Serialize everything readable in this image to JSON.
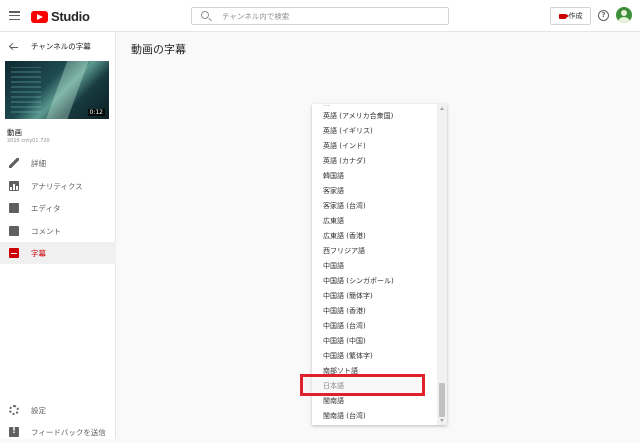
{
  "header": {
    "logo_text": "Studio",
    "search_placeholder": "チャンネル内で検索",
    "create_label": "作成",
    "help_symbol": "?"
  },
  "sidebar": {
    "back_label": "チャンネルの字幕",
    "video_duration": "0:12",
    "video_title": "動画",
    "video_subtitle": "2015 cnty01 720",
    "nav": [
      {
        "label": "詳細",
        "icon": "pencil-icon"
      },
      {
        "label": "アナリティクス",
        "icon": "analytics-icon"
      },
      {
        "label": "エディタ",
        "icon": "editor-icon"
      },
      {
        "label": "コメント",
        "icon": "comment-icon"
      },
      {
        "label": "字幕",
        "icon": "subtitles-icon",
        "active": true
      }
    ],
    "footer": [
      {
        "label": "設定",
        "icon": "gear-icon"
      },
      {
        "label": "フィードバックを送信",
        "icon": "feedback-icon"
      }
    ]
  },
  "main": {
    "title": "動画の字幕"
  },
  "language_dropdown": {
    "items": [
      "英語 (アメリカ合衆国)",
      "英語 (イギリス)",
      "英語 (インド)",
      "英語 (カナダ)",
      "韓国語",
      "客家語",
      "客家語 (台湾)",
      "広東語",
      "広東語 (香港)",
      "西フリジア語",
      "中国語",
      "中国語 (シンガポール)",
      "中国語 (簡体字)",
      "中国語 (香港)",
      "中国語 (台湾)",
      "中国語 (中国)",
      "中国語 (繁体字)",
      "南部ソト語",
      "日本語",
      "閩南語",
      "閩南語 (台湾)"
    ],
    "highlighted": "日本語"
  },
  "colors": {
    "accent_red": "#cc0000",
    "highlight_border": "#e0202a"
  }
}
